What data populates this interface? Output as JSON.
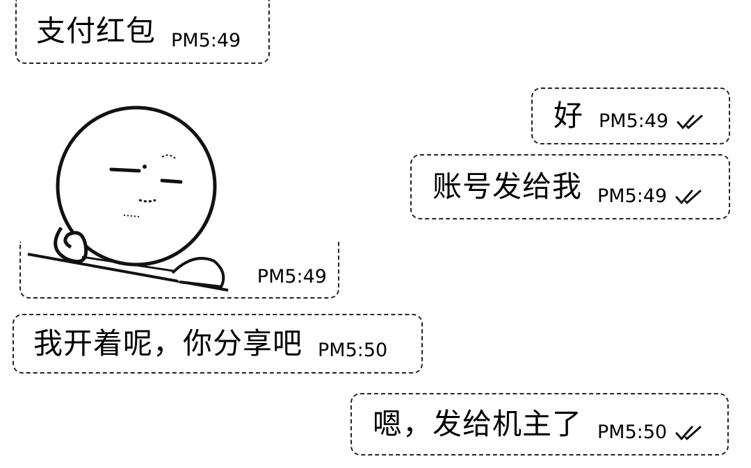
{
  "messages": [
    {
      "id": "msg1",
      "side": "left",
      "text": "支付红包",
      "time": "PM5:49"
    },
    {
      "id": "msg2",
      "side": "right",
      "text": "好",
      "time": "PM5:49",
      "read": true
    },
    {
      "id": "msg3",
      "side": "right",
      "text": "账号发给我",
      "time": "PM5:49",
      "read": true
    },
    {
      "id": "sticker",
      "side": "left",
      "type": "sticker",
      "icon": "round-face-sticker-icon",
      "time": "PM5:49"
    },
    {
      "id": "msg5",
      "side": "left",
      "text": "我开着呢，你分享吧",
      "time": "PM5:50"
    },
    {
      "id": "msg6",
      "side": "right",
      "text": "嗯，发给机主了",
      "time": "PM5:50",
      "read": true
    }
  ],
  "icons": {
    "read_receipt": "double-check-icon"
  }
}
